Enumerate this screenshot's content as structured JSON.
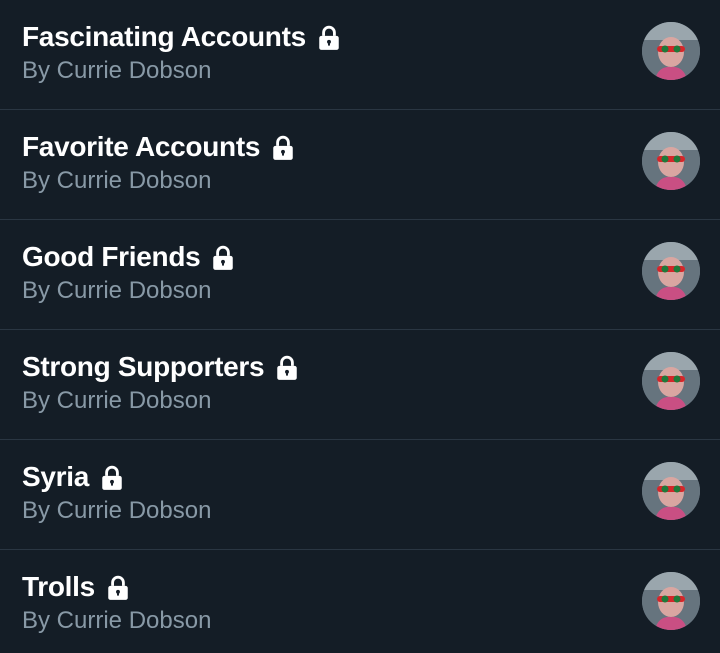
{
  "lists": [
    {
      "title": "Fascinating Accounts",
      "owner": "By Currie Dobson",
      "private": true
    },
    {
      "title": "Favorite Accounts",
      "owner": "By Currie Dobson",
      "private": true
    },
    {
      "title": "Good Friends",
      "owner": "By Currie Dobson",
      "private": true
    },
    {
      "title": "Strong Supporters",
      "owner": "By Currie Dobson",
      "private": true
    },
    {
      "title": "Syria",
      "owner": "By Currie Dobson",
      "private": true
    },
    {
      "title": "Trolls",
      "owner": "By Currie Dobson",
      "private": true
    }
  ],
  "icons": {
    "lock": "lock-icon",
    "avatar": "user-avatar"
  },
  "colors": {
    "background": "#141d26",
    "title": "#ffffff",
    "secondary": "#8899a6",
    "divider": "#2a3642"
  }
}
